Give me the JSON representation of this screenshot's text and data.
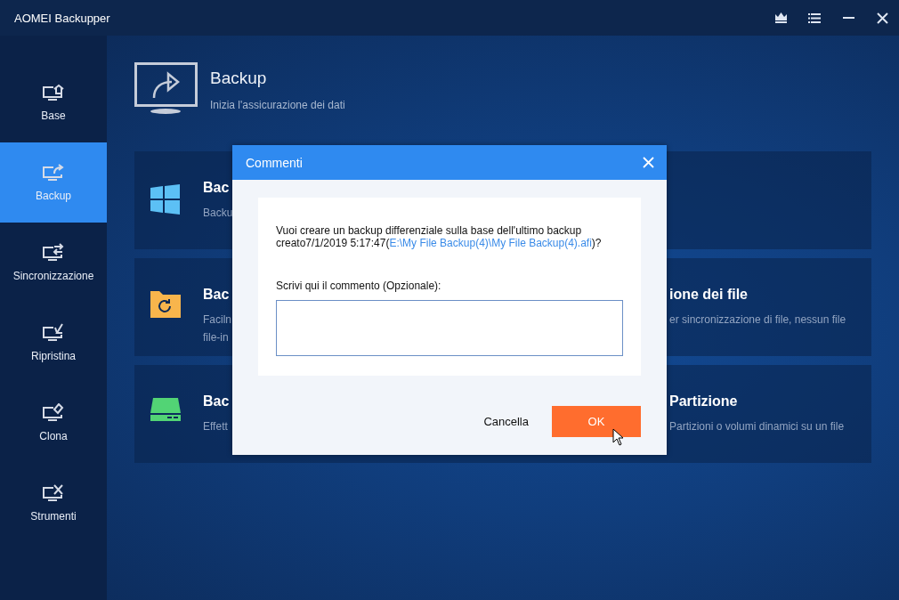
{
  "window": {
    "title": "AOMEI Backupper"
  },
  "title_bar_buttons": [
    {
      "kind": "crown"
    },
    {
      "kind": "menu"
    },
    {
      "kind": "minimize"
    },
    {
      "kind": "close"
    }
  ],
  "sidebar": {
    "items": [
      {
        "label": "Base",
        "kind": "home",
        "selected": false
      },
      {
        "label": "Backup",
        "kind": "share",
        "selected": true
      },
      {
        "label": "Sincronizzazione",
        "kind": "sync",
        "selected": false
      },
      {
        "label": "Ripristina",
        "kind": "restore",
        "selected": false
      },
      {
        "label": "Clona",
        "kind": "clone",
        "selected": false
      },
      {
        "label": "Strumenti",
        "kind": "tools",
        "selected": false
      }
    ]
  },
  "header": {
    "title": "Backup",
    "subtitle": "Inizia l'assicurazione dei dati"
  },
  "cards": [
    {
      "kind": "windows",
      "title_start": "Bac",
      "description_start": [
        "Backu"
      ]
    },
    {
      "kind": "folder",
      "title_start": "Bac",
      "description_start": [
        "Faciln",
        "file-in"
      ],
      "title_end": "ione dei file",
      "description_end": "er sincronizzazione di file, nessun file"
    },
    {
      "kind": "disk",
      "title_start": "Bac",
      "description_start": [
        "Effett"
      ],
      "title_end": "Partizione",
      "description_end": "Partizioni o volumi dinamici su un file"
    }
  ],
  "dialog": {
    "title": "Commenti",
    "message": "Vuoi creare un backup differenziale sulla base dell'ultimo backup creato7/1/2019 5:17:47(",
    "message_link": "E:\\My File Backup(4)\\My File Backup(4).afi",
    "message_end": ")?",
    "comment_label": "Scrivi qui il commento (Opzionale):",
    "buttons": [
      {
        "label": "Cancella",
        "kind": "secondary"
      },
      {
        "label": "OK",
        "kind": "primary"
      }
    ]
  }
}
